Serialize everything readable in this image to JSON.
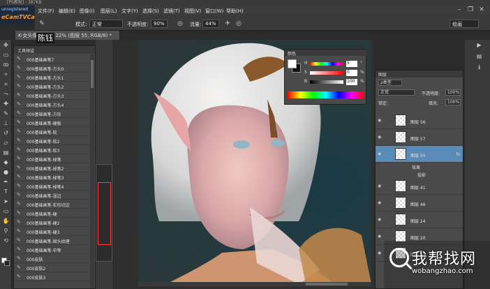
{
  "window": {
    "title": "[PS教程] - 387KB"
  },
  "watermark_top": {
    "line1": "unregistered",
    "line2": "eCamTVCam"
  },
  "menu": [
    "文件(F)",
    "编辑(E)",
    "图像(I)",
    "图层(L)",
    "文字(Y)",
    "选择(S)",
    "滤镜(T)",
    "视图(V)",
    "窗口(W)",
    "帮助(H)"
  ],
  "options_bar": {
    "mode_label": "模式:",
    "mode_value": "正常",
    "opacity_label": "不透明度:",
    "opacity_value": "90%",
    "flow_label": "流量:",
    "flow_value": "44%",
    "workspace_value": "绘画"
  },
  "document_tab": {
    "title": "K-女头像.psd @ 22% (图层 55, RGB/8) *"
  },
  "name_tag": "陈钰",
  "brush_presets": {
    "header": "工具预设",
    "items": [
      "000基础画笔7",
      "000基础画笔-方头0",
      "000基础画笔-方头1",
      "000基础画笔-方头2",
      "000基础画笔-方头3",
      "000基础画笔-方头4",
      "000基础画笔-方形",
      "000基础画笔-硬板",
      "000基础画笔-软",
      "000基础画笔-软2",
      "000基础画笔-软3",
      "000基础画笔-掉笔",
      "000基础画笔-掉笔2",
      "000基础画笔-掉笔3",
      "000基础画笔-掉笔4",
      "000基础画笔-湿边",
      "000基础画笔-实形切边",
      "000基础画笔-硬",
      "000基础画笔-硬2",
      "000基础画笔-硬3",
      "000基础画笔-固头纹理",
      "000基础画笔-中等",
      "000皮肤",
      "000皮肤2",
      "000皮肤3"
    ]
  },
  "color_panel": {
    "header": "颜色",
    "channels": [
      {
        "ch": "H",
        "value": "5",
        "unit": "°"
      },
      {
        "ch": "S",
        "value": "0",
        "unit": "%"
      },
      {
        "ch": "B",
        "value": "100",
        "unit": "%"
      }
    ]
  },
  "layers_panel": {
    "header": "图层",
    "kind_label": "ρ类型",
    "blend_value": "正常",
    "opacity_label": "不透明度:",
    "opacity_value": "100%",
    "lock_label": "锁定:",
    "fill_label": "填充:",
    "fill_value": "100%",
    "layers": [
      {
        "name": "图层 56",
        "fx": ""
      },
      {
        "name": "图层 57",
        "fx": ""
      },
      {
        "name": "图层 55",
        "fx": "fx"
      },
      {
        "name": "图层 41",
        "fx": ""
      },
      {
        "name": "图层 46",
        "fx": ""
      },
      {
        "name": "图层 24",
        "fx": ""
      },
      {
        "name": "图层 20",
        "fx": ""
      },
      {
        "name": "图层 49",
        "fx": ""
      }
    ],
    "effects_label": "效果",
    "drop_shadow_label": "投影"
  },
  "watermark": {
    "cn": "我帮找网",
    "url": "wobangzhao.com"
  },
  "colors": {
    "accent": "#5a8ab8",
    "panel": "#4a4a4a",
    "dark": "#3a3a3a"
  }
}
